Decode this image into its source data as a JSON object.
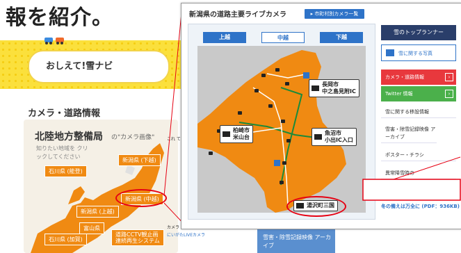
{
  "headline": "報を紹介。",
  "banner": {
    "title": "おしえて!雪ナビ"
  },
  "section": {
    "title": "カメラ・道路情報"
  },
  "panel": {
    "title": "北陸地方整備局",
    "subtitle": "の\"カメラ画像\"",
    "hint": "知りたい地域を クリックしてください",
    "regions": [
      {
        "label": "新潟県 (下越)"
      },
      {
        "label": "石川県 (能登)"
      },
      {
        "label": "新潟県 (中越)"
      },
      {
        "label": "新潟県 (上越)"
      },
      {
        "label": "富山県"
      },
      {
        "label": "石川県 (加賀)"
      },
      {
        "label": "道路CCTV観止画 連続再生システム"
      }
    ]
  },
  "side_text": "これ て!",
  "bottom_list": [
    "カメラ",
    "にいがたLIVEカメラ"
  ],
  "bottom_card": "雪害・除雪記録映像 アーカイブ",
  "popup": {
    "title": "新潟県の道路主要ライブカメラ",
    "link": "▸ 市町村別カメラ一覧",
    "tabs": [
      {
        "label": "上越",
        "active": false
      },
      {
        "label": "中越",
        "active": true
      },
      {
        "label": "下越",
        "active": false
      }
    ],
    "callouts": [
      {
        "line1": "長岡市",
        "line2": "中之島見附IC"
      },
      {
        "line1": "柏崎市",
        "line2": "米山台"
      },
      {
        "line1": "魚沼市",
        "line2": "小出IC入口"
      },
      {
        "line1": "湯沢町三国",
        "line2": ""
      }
    ],
    "sidebar": {
      "banner": "雪のトップランナー",
      "photo": "雪に関する写真",
      "buttons": [
        {
          "label": "カメラ・道路情報",
          "color": "#e8383d"
        },
        {
          "label": "Twitter 情報",
          "color": "#4bb04b"
        }
      ],
      "links": [
        "雪に関する移設情報",
        "雪害・除雪記録映像 アーカイブ",
        "ポスター・チラシ",
        "異常降雪時の"
      ],
      "prep": "冬の備えは万全に (PDF：936KB)"
    }
  },
  "colors": {
    "orange": "#f08a12",
    "blue": "#2e73c8",
    "red": "#e60012",
    "yellow": "#fbe03c"
  }
}
